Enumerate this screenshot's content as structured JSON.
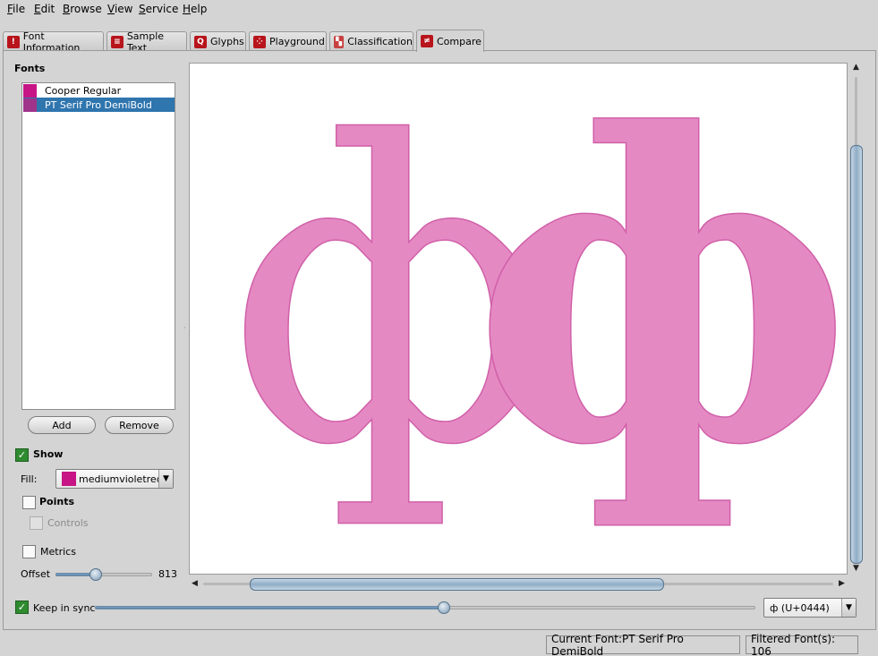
{
  "menu": [
    "File",
    "Edit",
    "Browse",
    "View",
    "Service",
    "Help"
  ],
  "tabs": [
    {
      "label": "Font Information",
      "icon": "font-info-icon",
      "active": false
    },
    {
      "label": "Sample Text",
      "icon": "sample-text-icon",
      "active": false
    },
    {
      "label": "Glyphs",
      "icon": "glyphs-icon",
      "active": false
    },
    {
      "label": "Playground",
      "icon": "playground-icon",
      "active": false
    },
    {
      "label": "Classification",
      "icon": "classification-icon",
      "active": false
    },
    {
      "label": "Compare",
      "icon": "compare-icon",
      "active": true
    }
  ],
  "fonts_panel": {
    "title": "Fonts",
    "items": [
      {
        "name": "Cooper Regular",
        "color": "#c71585",
        "selected": false
      },
      {
        "name": "PT Serif Pro DemiBold",
        "color": "#a0338a",
        "selected": true
      }
    ],
    "add_label": "Add",
    "remove_label": "Remove"
  },
  "options": {
    "show_label": "Show",
    "show_checked": true,
    "fill_label": "Fill:",
    "fill_value": "mediumvioletred",
    "fill_color": "#c71585",
    "points_label": "Points",
    "points_checked": false,
    "controls_label": "Controls",
    "controls_checked": false,
    "metrics_label": "Metrics",
    "metrics_checked": false,
    "offset_label": "Offset",
    "offset_value": "813"
  },
  "bottom": {
    "keep_sync_label": "Keep in sync",
    "keep_sync_checked": true,
    "glyph_select": "ф  (U+0444)"
  },
  "preview": {
    "glyph": "ф",
    "glyph_fill": "#e589c3",
    "glyph_stroke": "#d060a8"
  },
  "status": {
    "current_font": "Current Font:PT Serif Pro DemiBold",
    "filtered": "Filtered Font(s): 106"
  }
}
